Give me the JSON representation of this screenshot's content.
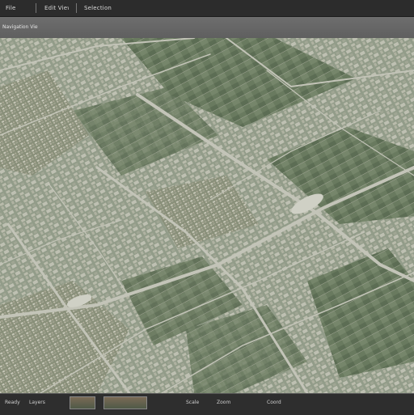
{
  "titlebar": {
    "menu": [
      {
        "label": "File"
      },
      {
        "label": "Edit View"
      },
      {
        "label": "Selection"
      }
    ]
  },
  "toolbar": {
    "label": "Navigation View"
  },
  "map": {
    "field_color": "#8e9a84",
    "field_dark": "#5d6e56",
    "road_color": "#c8c8bd",
    "block_color": "#b7b9ab"
  },
  "statusbar": {
    "items": [
      {
        "label": "Ready"
      },
      {
        "label": "Layers"
      },
      {
        "label": "Scale"
      },
      {
        "label": "Zoom"
      },
      {
        "label": "Coord"
      }
    ]
  }
}
